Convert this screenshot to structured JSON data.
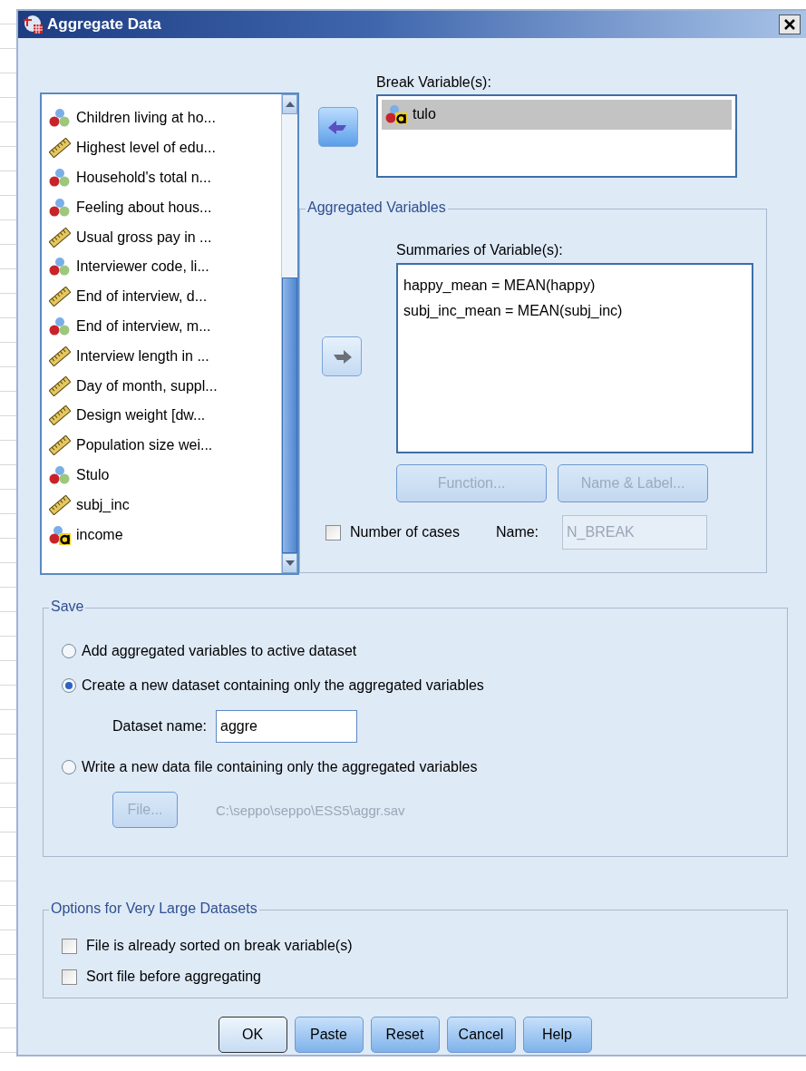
{
  "window": {
    "title": "Aggregate Data"
  },
  "variables": [
    {
      "label": "Children living at ho...",
      "kind": "nominal",
      "selected": false
    },
    {
      "label": "Highest level of edu...",
      "kind": "scale",
      "selected": false
    },
    {
      "label": "Household's total n...",
      "kind": "nominal",
      "selected": false
    },
    {
      "label": "Feeling about hous...",
      "kind": "nominal",
      "selected": false
    },
    {
      "label": "Usual gross pay in ...",
      "kind": "scale",
      "selected": false
    },
    {
      "label": "Interviewer code, li...",
      "kind": "nominal",
      "selected": false
    },
    {
      "label": "End of interview, d...",
      "kind": "scale",
      "selected": false
    },
    {
      "label": "End of interview, m...",
      "kind": "nominal",
      "selected": false
    },
    {
      "label": "Interview length in ...",
      "kind": "scale",
      "selected": false
    },
    {
      "label": "Day of month, suppl...",
      "kind": "scale",
      "selected": false
    },
    {
      "label": "Design weight [dw...",
      "kind": "scale",
      "selected": false
    },
    {
      "label": "Population size wei...",
      "kind": "scale",
      "selected": false
    },
    {
      "label": "Stulo",
      "kind": "nominal",
      "selected": false
    },
    {
      "label": "subj_inc",
      "kind": "scale",
      "selected": false
    },
    {
      "label": "income",
      "kind": "string",
      "selected": false
    }
  ],
  "break_variables": {
    "label": "Break Variable(s):",
    "items": [
      {
        "label": "tulo",
        "kind": "string",
        "selected": true
      }
    ]
  },
  "aggregated_variables": {
    "title": "Aggregated Variables",
    "label": "Summaries of Variable(s):",
    "items": [
      "happy_mean = MEAN(happy)",
      "subj_inc_mean = MEAN(subj_inc)"
    ],
    "buttons": [
      {
        "label": "Function...",
        "disabled": true
      },
      {
        "label": "Name & Label...",
        "disabled": true
      }
    ],
    "number_of_cases": {
      "label": "Number of cases",
      "checked": false
    },
    "name": {
      "label": "Name:",
      "value": "N_BREAK",
      "disabled": true
    }
  },
  "save": {
    "title": "Save",
    "options": [
      {
        "label": "Add aggregated variables to active dataset",
        "selected": false
      },
      {
        "label": "Create a new dataset containing only the aggregated variables",
        "selected": true
      },
      {
        "label": "Write a new data file containing only the aggregated variables",
        "selected": false
      }
    ],
    "dataset_name": {
      "label": "Dataset name:",
      "value": "aggre"
    },
    "file_button": {
      "label": "File...",
      "disabled": true
    },
    "file_path": "C:\\seppo\\seppo\\ESS5\\aggr.sav"
  },
  "options": {
    "title": "Options for Very Large Datasets",
    "items": [
      {
        "label": "File is already sorted on break variable(s)",
        "checked": false
      },
      {
        "label": "Sort file before aggregating",
        "checked": false
      }
    ]
  },
  "buttons": [
    {
      "label": "OK",
      "default": true
    },
    {
      "label": "Paste",
      "default": false
    },
    {
      "label": "Reset",
      "default": false
    },
    {
      "label": "Cancel",
      "default": false
    },
    {
      "label": "Help",
      "default": false
    }
  ]
}
